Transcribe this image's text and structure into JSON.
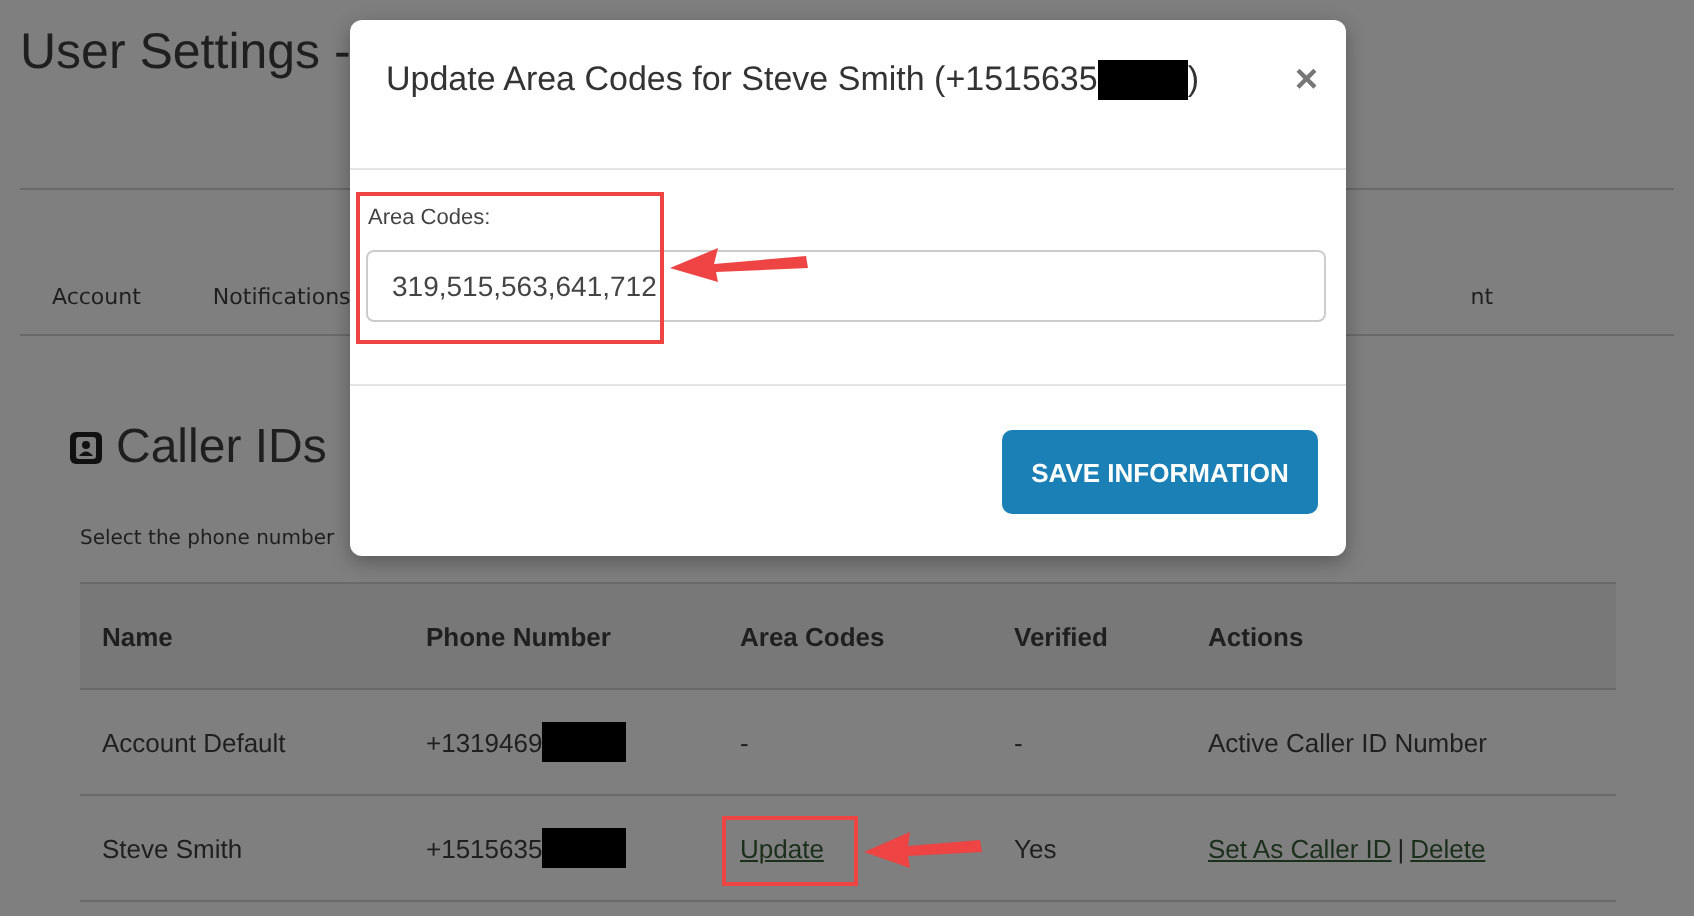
{
  "page": {
    "title": "User Settings -"
  },
  "tabs": [
    {
      "label": "Account"
    },
    {
      "label": "Notifications"
    },
    {
      "label": "nt"
    }
  ],
  "section": {
    "title": "Caller IDs",
    "description": "Select the phone number"
  },
  "table": {
    "columns": [
      "Name",
      "Phone Number",
      "Area Codes",
      "Verified",
      "Actions"
    ],
    "rows": [
      {
        "name": "Account Default",
        "phone": "+1319469",
        "area_codes": {
          "kind": "text",
          "text": "-"
        },
        "verified": "-",
        "actions": [
          {
            "kind": "text",
            "text": "Active Caller ID Number"
          }
        ]
      },
      {
        "name": "Steve Smith",
        "phone": "+1515635",
        "area_codes": {
          "kind": "link",
          "text": "Update"
        },
        "verified": "Yes",
        "actions": [
          {
            "kind": "link",
            "text": "Set As Caller ID"
          },
          {
            "kind": "separator",
            "text": "|"
          },
          {
            "kind": "link",
            "text": "Delete"
          }
        ]
      }
    ]
  },
  "modal": {
    "title": "Update Area Codes for Steve Smith (+1515635",
    "title_end": ")",
    "close": "×",
    "field_label": "Area Codes:",
    "field_value": "319,515,563,641,712",
    "button": "SAVE INFORMATION"
  }
}
